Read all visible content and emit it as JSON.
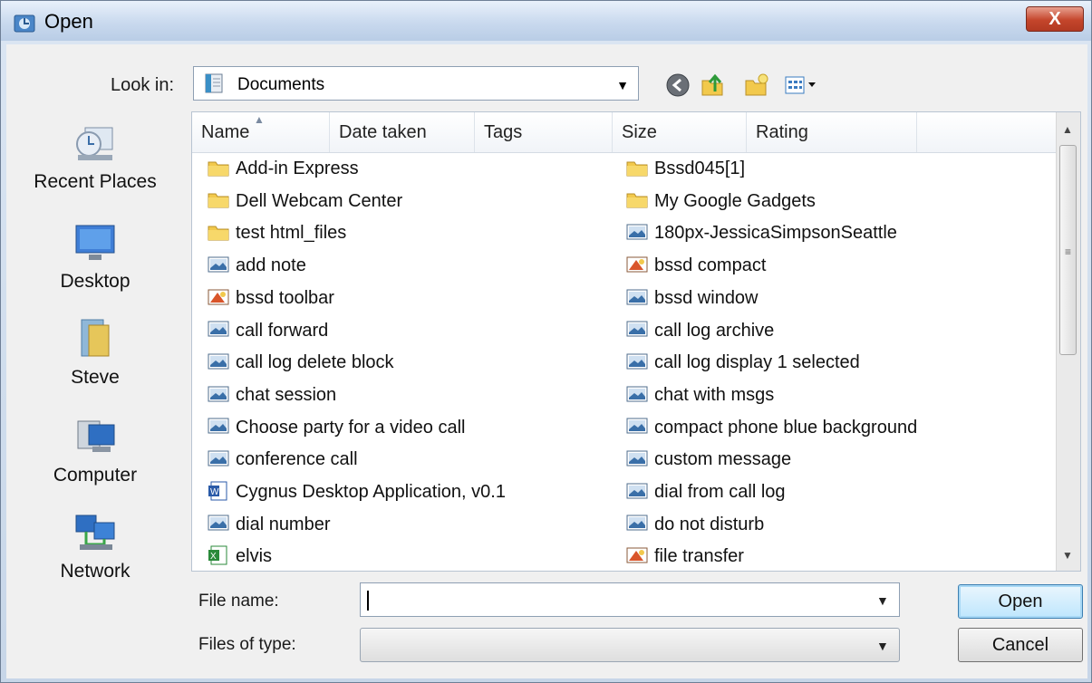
{
  "window": {
    "title": "Open",
    "close_label": "X"
  },
  "lookin": {
    "label": "Look in:",
    "value": "Documents"
  },
  "toolbar": {
    "icons": [
      "back-icon",
      "up-folder-icon",
      "new-folder-icon",
      "views-menu-icon"
    ]
  },
  "places": [
    {
      "label": "Recent Places",
      "icon": "recent-places-icon"
    },
    {
      "label": "Desktop",
      "icon": "desktop-icon"
    },
    {
      "label": "Steve",
      "icon": "user-folder-icon"
    },
    {
      "label": "Computer",
      "icon": "computer-icon"
    },
    {
      "label": "Network",
      "icon": "network-icon"
    }
  ],
  "columns": [
    "Name",
    "Date taken",
    "Tags",
    "Size",
    "Rating"
  ],
  "files_left": [
    {
      "name": "Add-in Express",
      "type": "folder"
    },
    {
      "name": "Dell Webcam Center",
      "type": "folder"
    },
    {
      "name": "test html_files",
      "type": "folder"
    },
    {
      "name": "add note",
      "type": "image"
    },
    {
      "name": "bssd toolbar",
      "type": "paint"
    },
    {
      "name": "call forward",
      "type": "image"
    },
    {
      "name": "call log delete block",
      "type": "image"
    },
    {
      "name": "chat session",
      "type": "image"
    },
    {
      "name": "Choose party for a video call",
      "type": "image"
    },
    {
      "name": "conference call",
      "type": "image"
    },
    {
      "name": "Cygnus Desktop Application, v0.1",
      "type": "word"
    },
    {
      "name": "dial number",
      "type": "image"
    },
    {
      "name": "elvis",
      "type": "excel"
    }
  ],
  "files_right": [
    {
      "name": "Bssd045[1]",
      "type": "folder"
    },
    {
      "name": "My Google Gadgets",
      "type": "folder"
    },
    {
      "name": "180px-JessicaSimpsonSeattle",
      "type": "image"
    },
    {
      "name": "bssd compact",
      "type": "paint"
    },
    {
      "name": "bssd window",
      "type": "image"
    },
    {
      "name": "call log archive",
      "type": "image"
    },
    {
      "name": "call log display 1 selected",
      "type": "image"
    },
    {
      "name": "chat with msgs",
      "type": "image"
    },
    {
      "name": "compact phone blue background",
      "type": "image"
    },
    {
      "name": "custom message",
      "type": "image"
    },
    {
      "name": "dial from call log",
      "type": "image"
    },
    {
      "name": "do not disturb",
      "type": "image"
    },
    {
      "name": "file transfer",
      "type": "paint"
    }
  ],
  "filename": {
    "label": "File name:",
    "value": ""
  },
  "filetype": {
    "label": "Files of type:",
    "value": ""
  },
  "buttons": {
    "open": "Open",
    "cancel": "Cancel"
  }
}
